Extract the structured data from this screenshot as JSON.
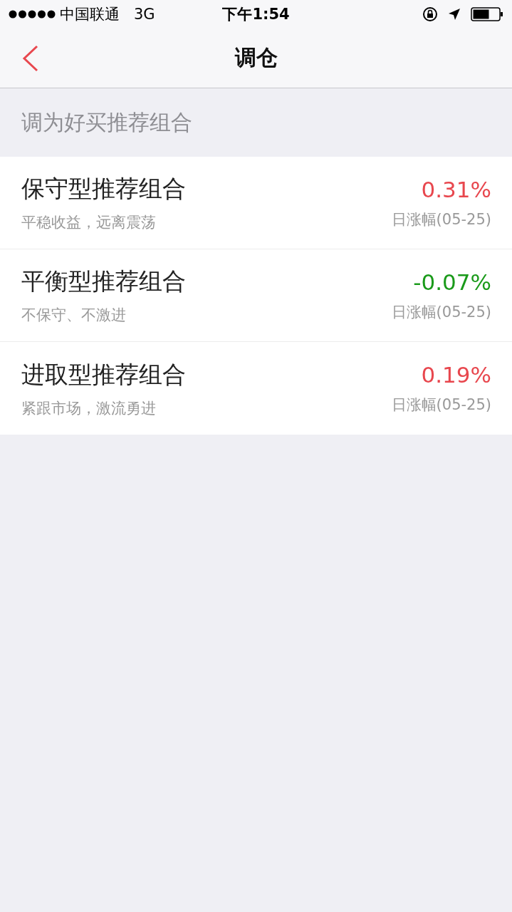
{
  "status_bar": {
    "carrier": "中国联通",
    "network": "3G",
    "time": "下午1:54"
  },
  "nav": {
    "title": "调仓"
  },
  "section": {
    "title": "调为好买推荐组合"
  },
  "portfolios": [
    {
      "name": "保守型推荐组合",
      "description": "平稳收益，远离震荡",
      "change": "0.31%",
      "color": "#e8474e",
      "change_label": "日涨幅(05-25)"
    },
    {
      "name": "平衡型推荐组合",
      "description": "不保守、不激进",
      "change": "-0.07%",
      "color": "#1a9a1a",
      "change_label": "日涨幅(05-25)"
    },
    {
      "name": "进取型推荐组合",
      "description": "紧跟市场，激流勇进",
      "change": "0.19%",
      "color": "#e8474e",
      "change_label": "日涨幅(05-25)"
    }
  ]
}
